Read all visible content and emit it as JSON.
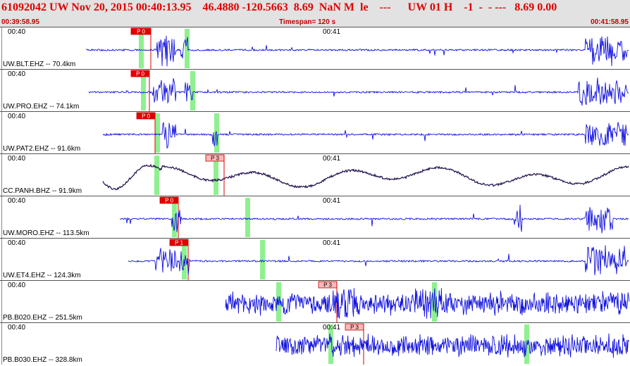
{
  "header": {
    "title": "61092042 UW Nov 20, 2015 00:40:13.95    46.4880 -120.5663  8.69  NaN M  le    ---      UW 01 H    -1  -  - ---   8.69 0.00",
    "start_time": "00:39:58.95",
    "timespan": "Timespan= 120 s",
    "end_time": "00:41:58.95"
  },
  "time_marks": {
    "first": "00:40",
    "second": "00:41"
  },
  "colors": {
    "trace": "#1010e0",
    "trace_dark": "#2a1a55",
    "green": "#8ff08f",
    "pick_dark": "#e00000",
    "pick_light": "#f8b8b8"
  },
  "panels": [
    {
      "label": "UW.BLT.EHZ -- 70.4km",
      "pick": "P 0",
      "pick_style": "dark",
      "show_41": true,
      "trace_style": "normal"
    },
    {
      "label": "UW.PRO.EHZ -- 74.1km",
      "pick": "P 0",
      "pick_style": "dark",
      "show_41": false,
      "trace_style": "normal"
    },
    {
      "label": "UW.PAT2.EHZ -- 91.6km",
      "pick": "P 0",
      "pick_style": "dark",
      "show_41": false,
      "trace_style": "normal"
    },
    {
      "label": "CC.PANH.BHZ -- 91.9km",
      "pick": "P 3",
      "pick_style": "light",
      "show_41": true,
      "trace_style": "long"
    },
    {
      "label": "UW.MORO.EHZ -- 113.5km",
      "pick": "P 0",
      "pick_style": "dark",
      "show_41": true,
      "trace_style": "normal"
    },
    {
      "label": "UW.ET4.EHZ -- 124.3km",
      "pick": "P 1",
      "pick_style": "dark",
      "show_41": true,
      "trace_style": "normal"
    },
    {
      "label": "PB.B020.EHZ -- 251.5km",
      "pick": "P 3",
      "pick_style": "light",
      "show_41": false,
      "trace_style": "noisy"
    },
    {
      "label": "PB.B030.EHZ -- 328.8km",
      "pick": "P 3",
      "pick_style": "light",
      "show_41": true,
      "trace_style": "noisy"
    }
  ]
}
